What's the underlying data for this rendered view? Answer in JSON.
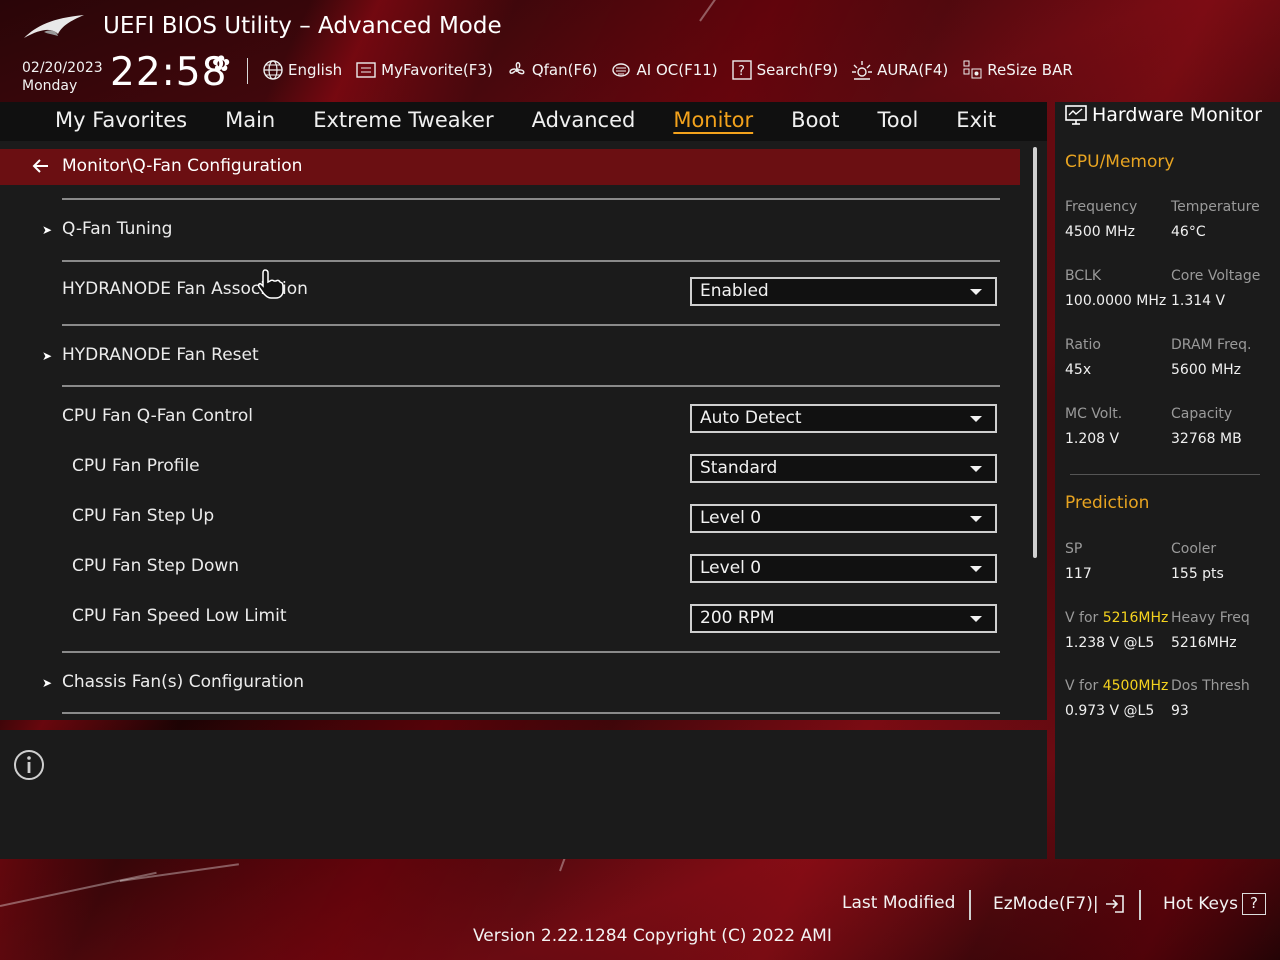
{
  "app": {
    "title": "UEFI BIOS Utility – Advanced Mode"
  },
  "clock": {
    "date": "02/20/2023",
    "day": "Monday",
    "time": "22:58"
  },
  "toolbar": {
    "items": [
      {
        "label": "English",
        "icon": "globe-icon"
      },
      {
        "label": "MyFavorite(F3)",
        "icon": "favorite-icon"
      },
      {
        "label": "Qfan(F6)",
        "icon": "fan-icon"
      },
      {
        "label": "AI OC(F11)",
        "icon": "ai-oc-icon"
      },
      {
        "label": "Search(F9)",
        "icon": "search-icon"
      },
      {
        "label": "AURA(F4)",
        "icon": "aura-icon"
      },
      {
        "label": "ReSize BAR",
        "icon": "resize-bar-icon"
      }
    ]
  },
  "tabs": [
    {
      "label": "My Favorites",
      "active": false
    },
    {
      "label": "Main",
      "active": false
    },
    {
      "label": "Extreme Tweaker",
      "active": false
    },
    {
      "label": "Advanced",
      "active": false
    },
    {
      "label": "Monitor",
      "active": true
    },
    {
      "label": "Boot",
      "active": false
    },
    {
      "label": "Tool",
      "active": false
    },
    {
      "label": "Exit",
      "active": false
    }
  ],
  "breadcrumb": "Monitor\\Q-Fan Configuration",
  "settings": {
    "qfan_tuning": "Q-Fan Tuning",
    "hydranode_assoc": {
      "label": "HYDRANODE Fan Association",
      "value": "Enabled"
    },
    "hydranode_reset": "HYDRANODE Fan Reset",
    "cpu_qfan_control": {
      "label": "CPU Fan Q-Fan Control",
      "value": "Auto Detect"
    },
    "cpu_fan_profile": {
      "label": "CPU Fan Profile",
      "value": "Standard"
    },
    "cpu_fan_step_up": {
      "label": "CPU Fan Step Up",
      "value": "Level 0"
    },
    "cpu_fan_step_down": {
      "label": "CPU Fan Step Down",
      "value": "Level 0"
    },
    "cpu_fan_low_limit": {
      "label": "CPU Fan Speed Low Limit",
      "value": "200 RPM"
    },
    "chassis_fans": "Chassis Fan(s) Configuration"
  },
  "hardware_monitor": {
    "title": "Hardware Monitor",
    "cpu_memory": {
      "heading": "CPU/Memory",
      "frequency": {
        "label": "Frequency",
        "value": "4500 MHz"
      },
      "temperature": {
        "label": "Temperature",
        "value": "46°C"
      },
      "bclk": {
        "label": "BCLK",
        "value": "100.0000 MHz"
      },
      "core_voltage": {
        "label": "Core Voltage",
        "value": "1.314 V"
      },
      "ratio": {
        "label": "Ratio",
        "value": "45x"
      },
      "dram_freq": {
        "label": "DRAM Freq.",
        "value": "5600 MHz"
      },
      "mc_volt": {
        "label": "MC Volt.",
        "value": "1.208 V"
      },
      "capacity": {
        "label": "Capacity",
        "value": "32768 MB"
      }
    },
    "prediction": {
      "heading": "Prediction",
      "sp": {
        "label": "SP",
        "value": "117"
      },
      "cooler": {
        "label": "Cooler",
        "value": "155 pts"
      },
      "v_for_1": {
        "prefix": "V for ",
        "freq": "5216MHz",
        "value": "1.238 V @L5"
      },
      "heavy_freq": {
        "label": "Heavy Freq",
        "value": "5216MHz"
      },
      "v_for_2": {
        "prefix": "V for ",
        "freq": "4500MHz",
        "value": "0.973 V @L5"
      },
      "dos_thresh": {
        "label": "Dos Thresh",
        "value": "93"
      }
    }
  },
  "footer": {
    "last_modified": "Last Modified",
    "ezmode": "EzMode(F7)|",
    "hot_keys": "Hot Keys",
    "hot_keys_glyph": "?",
    "version": "Version 2.22.1284 Copyright (C) 2022 AMI"
  },
  "colors": {
    "accent": "#f3a21c",
    "breadcrumb_bg": "#6b0f12",
    "highlight": "#f5d31e"
  }
}
